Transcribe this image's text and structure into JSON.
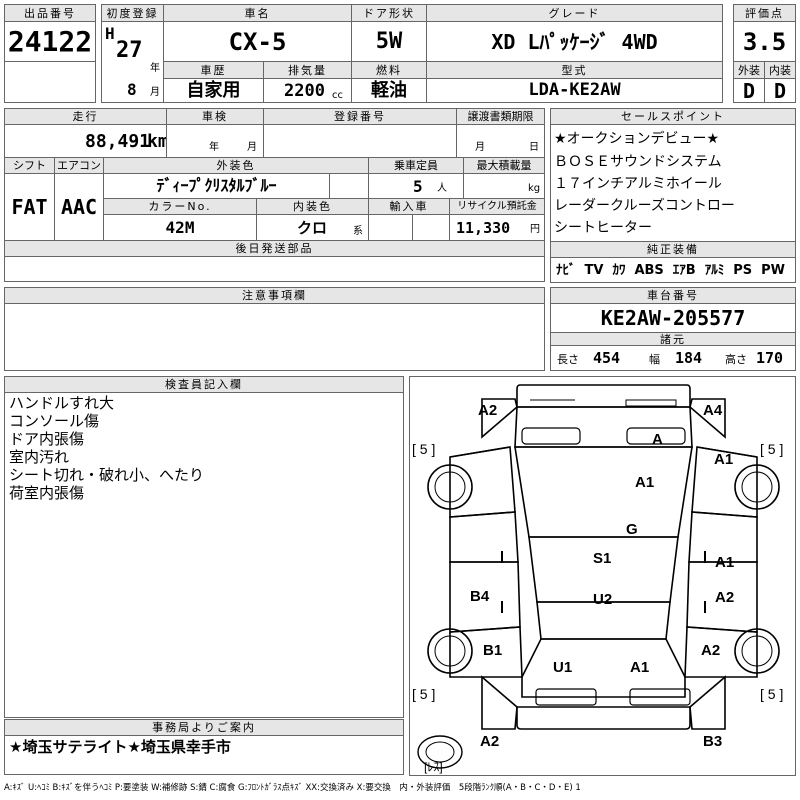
{
  "header": {
    "lot_no_label": "出品番号",
    "lot_no": "24122",
    "first_reg_label": "初度登録",
    "era": "H",
    "year": "27",
    "year_unit": "年",
    "month": "8",
    "month_unit": "月",
    "car_name_label": "車名",
    "car_name": "CX-5",
    "door_label": "ドア形状",
    "door": "5W",
    "grade_label": "グレード",
    "grade": "XD Lﾊﾟｯｹｰｼﾞ 4WD",
    "score_label": "評価点",
    "score": "3.5",
    "history_label": "車歴",
    "history": "自家用",
    "displacement_label": "排気量",
    "displacement": "2200",
    "displacement_unit": "cc",
    "fuel_label": "燃料",
    "fuel": "軽油",
    "model_label": "型式",
    "model": "LDA-KE2AW",
    "exterior_label": "外装",
    "exterior": "D",
    "interior_label": "内装",
    "interior": "D"
  },
  "specs": {
    "mileage_label": "走行",
    "mileage": "88,491",
    "mileage_unit": "km",
    "inspection_label": "車検",
    "inspection_year_unit": "年",
    "inspection_month_unit": "月",
    "plate_label": "登録番号",
    "transfer_label": "譲渡書類期限",
    "transfer_month_unit": "月",
    "transfer_day_unit": "日",
    "shift_label": "シフト",
    "shift": "FAT",
    "ac_label": "エアコン",
    "ac": "AAC",
    "color_label": "外装色",
    "color": "ﾃﾞｨｰﾌﾟｸﾘｽﾀﾙﾌﾞﾙｰ",
    "capacity_label": "乗車定員",
    "capacity": "5",
    "capacity_unit": "人",
    "load_label": "最大積載量",
    "load_unit": "kg",
    "color_no_label": "カラーNo.",
    "color_no": "42M",
    "interior_color_label": "内装色",
    "interior_color": "クロ",
    "interior_color_suffix": "系",
    "import_label": "輸入車",
    "recycle_label": "リサイクル預託金",
    "recycle": "11,330",
    "recycle_unit": "円"
  },
  "later_parts_label": "後日発送部品",
  "notes_label": "注意事項欄",
  "sales_points": {
    "label": "セールスポイント",
    "items": [
      "★オークションデビュー★",
      "ＢＯＳＥサウンドシステム",
      "１７インチアルミホイール",
      "レーダークルーズコントロー",
      "シートヒーター"
    ]
  },
  "equipment": {
    "label": "純正装備",
    "items": [
      "ﾅﾋﾞ",
      "TV",
      "ｶﾜ",
      "ABS",
      "ｴｱB",
      "ｱﾙﾐ",
      "PS",
      "PW"
    ]
  },
  "chassis": {
    "label": "車台番号",
    "number": "KE2AW-205577",
    "dims_label": "諸元",
    "length_label": "長さ",
    "length": "454",
    "width_label": "幅",
    "width": "184",
    "height_label": "高さ",
    "height": "170"
  },
  "inspector": {
    "label": "検査員記入欄",
    "lines": [
      "ハンドルすれ大",
      "コンソール傷",
      "ドア内張傷",
      "室内汚れ",
      "シート切れ・破れ小、へたり",
      "荷室内張傷"
    ]
  },
  "office": {
    "label": "事務局よりご案内",
    "text": "★埼玉サテライト★埼玉県幸手市"
  },
  "diagram": {
    "marks": {
      "fl_corner": "A2",
      "fr_corner": "A4",
      "bonnet_a": "A",
      "fender_r": "A1",
      "hood": "A1",
      "windshield": "G",
      "roof": "S1",
      "door_fr": "A1",
      "door_rl": "B4",
      "floor": "U2",
      "door_rr": "A2",
      "quarter_l": "B1",
      "quarter_r": "A2",
      "rear_seat": "U1",
      "rear_panel": "A1",
      "rl_corner": "A2",
      "rr_corner": "B3"
    },
    "tire_fl": "[ 5 ]",
    "tire_fr": "[ 5 ]",
    "tire_rl": "[ 5 ]",
    "tire_rr": "[ 5 ]",
    "spare": "[ﾚｽ]"
  },
  "legend": "A:ｷｽﾞ U:ﾍｺﾐ B:ｷｽﾞを伴うﾍｺﾐ P:要塗装 W:補修跡 S:錆 C:腐食 G:ﾌﾛﾝﾄｶﾞﾗｽ点ｷｽﾞ XX:交換済み X:要交換　内・外装評価　5段階ﾗﾝｸ順(A・B・C・D・E) 1"
}
